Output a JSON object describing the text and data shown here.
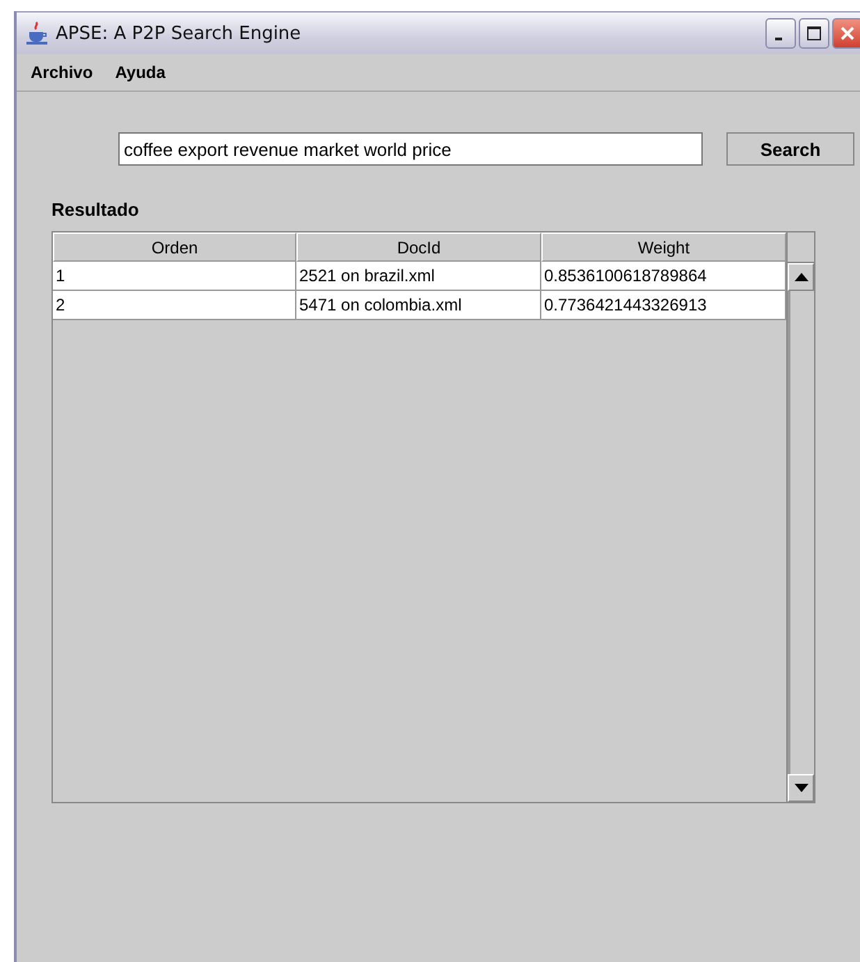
{
  "window": {
    "title": "APSE: A P2P Search Engine"
  },
  "menu": [
    "Archivo",
    "Ayuda"
  ],
  "search": {
    "value": "coffee export revenue market world price",
    "button": "Search"
  },
  "results": {
    "label": "Resultado",
    "columns": [
      "Orden",
      "DocId",
      "Weight"
    ],
    "rows": [
      {
        "cells": [
          "1",
          "2521 on brazil.xml",
          "0.8536100618789864"
        ]
      },
      {
        "cells": [
          "2",
          "5471 on colombia.xml",
          "0.7736421443326913"
        ]
      }
    ]
  }
}
